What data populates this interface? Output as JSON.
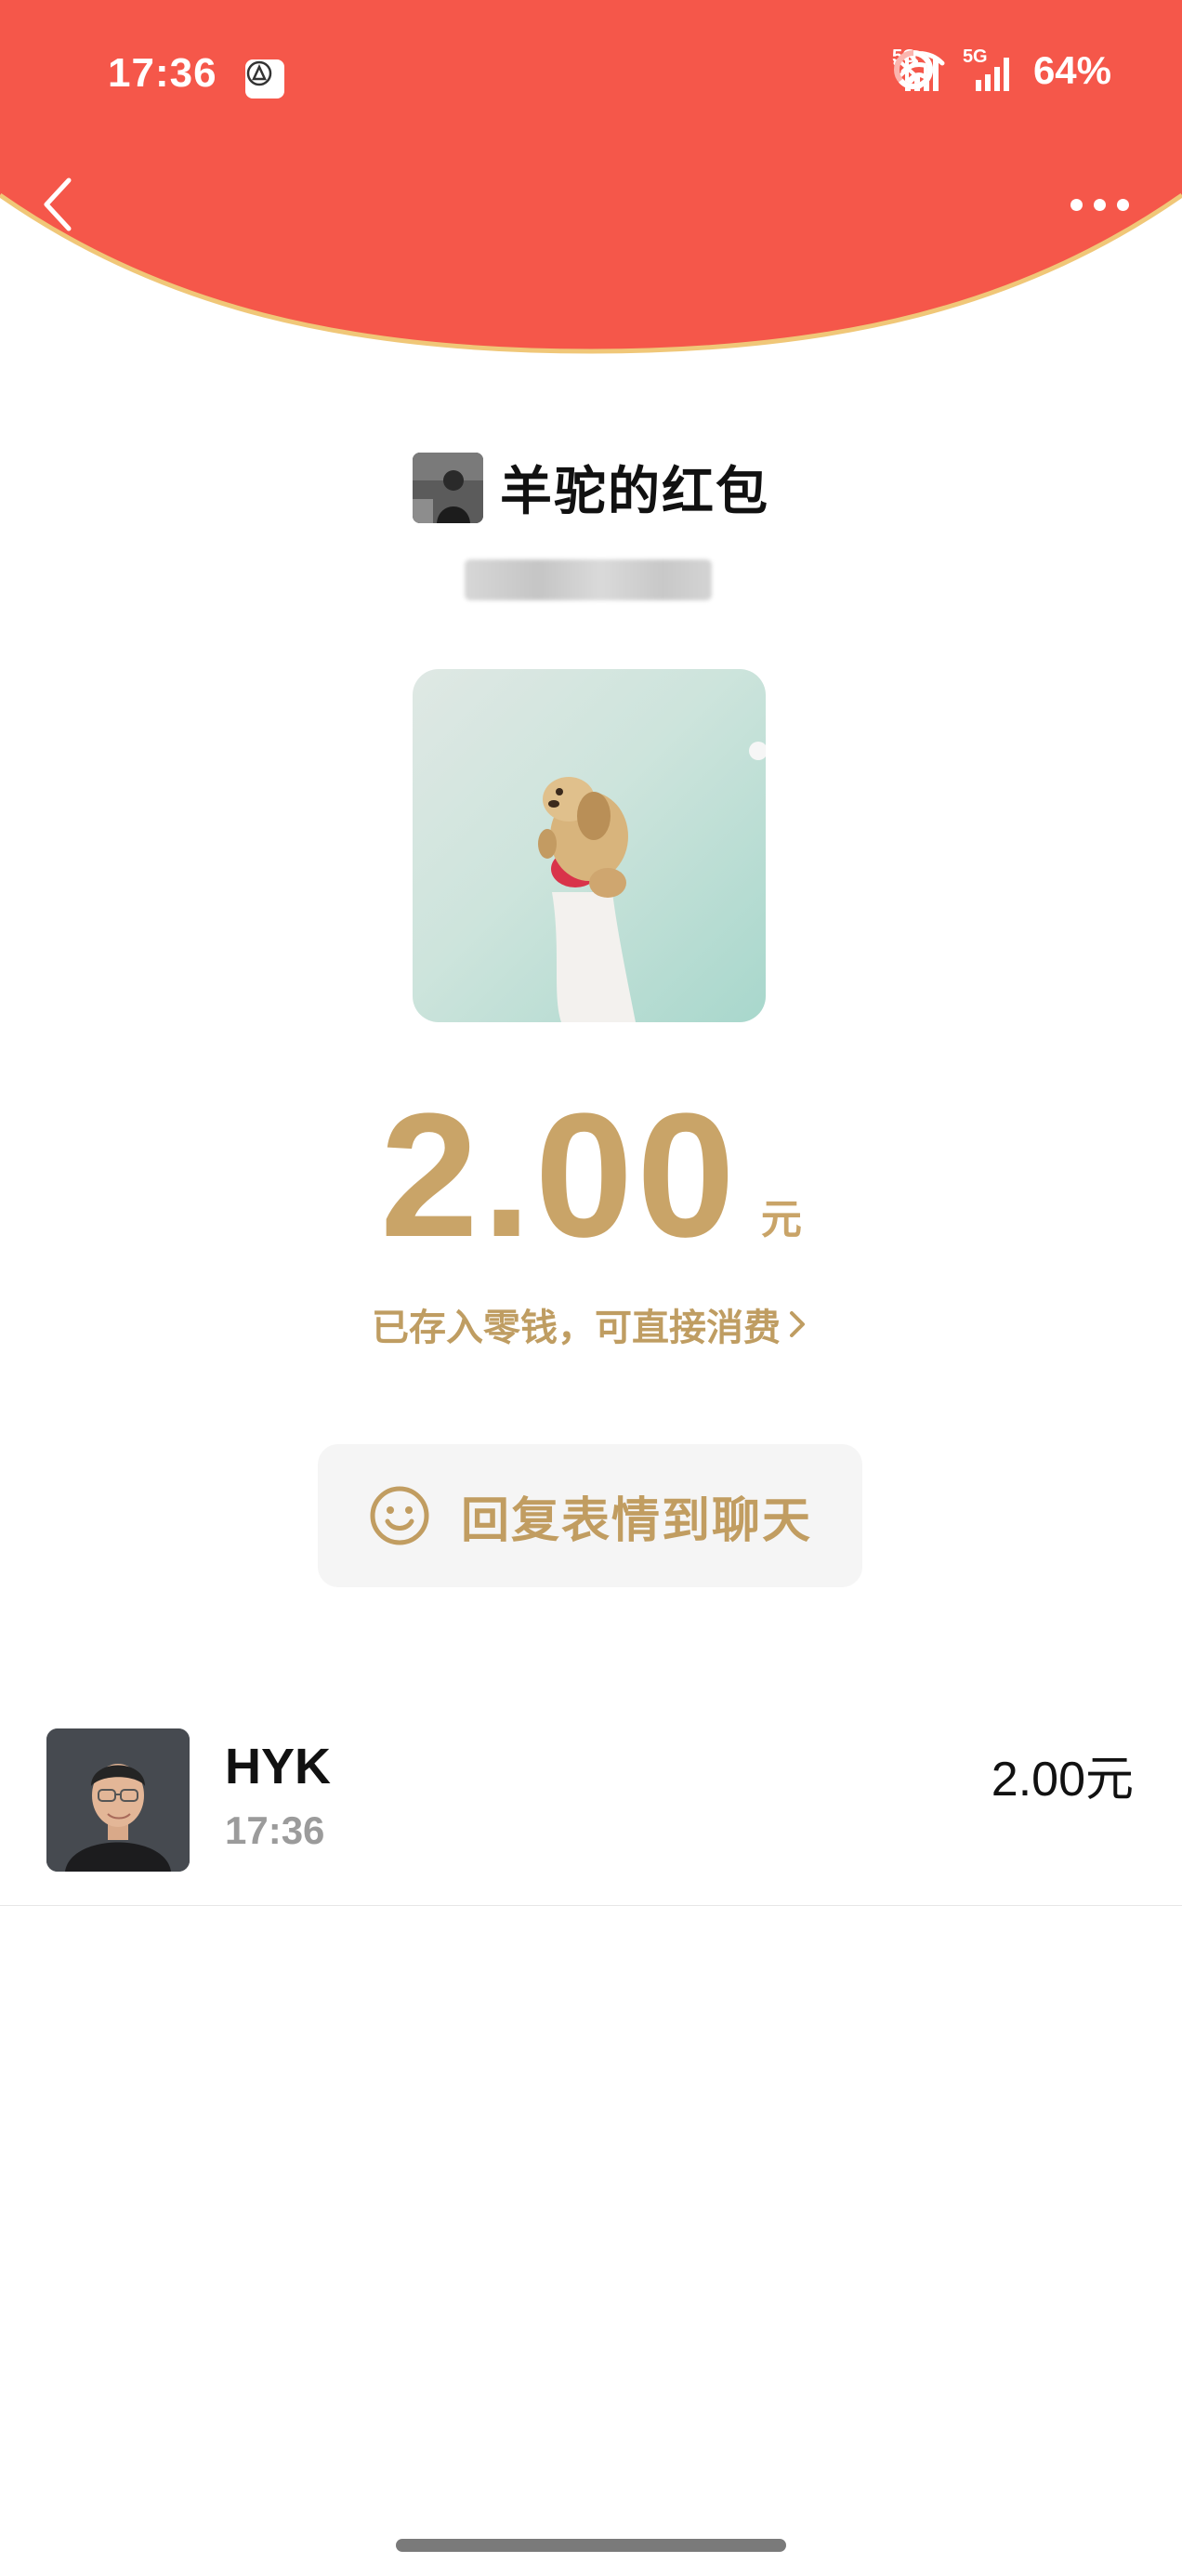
{
  "status_bar": {
    "time": "17:36",
    "battery": "64%",
    "signal_1": "5G",
    "signal_2": "5G"
  },
  "header": {
    "bg_color": "#f5574a",
    "border_color": "#f0c778"
  },
  "red_packet": {
    "title": "羊驼的红包",
    "amount": "2.00",
    "unit": "元",
    "wallet_text": "已存入零钱，可直接消费",
    "reply_label": "回复表情到聊天",
    "accent_color": "#c9a468"
  },
  "receivers": [
    {
      "name": "HYK",
      "time": "17:36",
      "amount": "2.00元"
    }
  ]
}
